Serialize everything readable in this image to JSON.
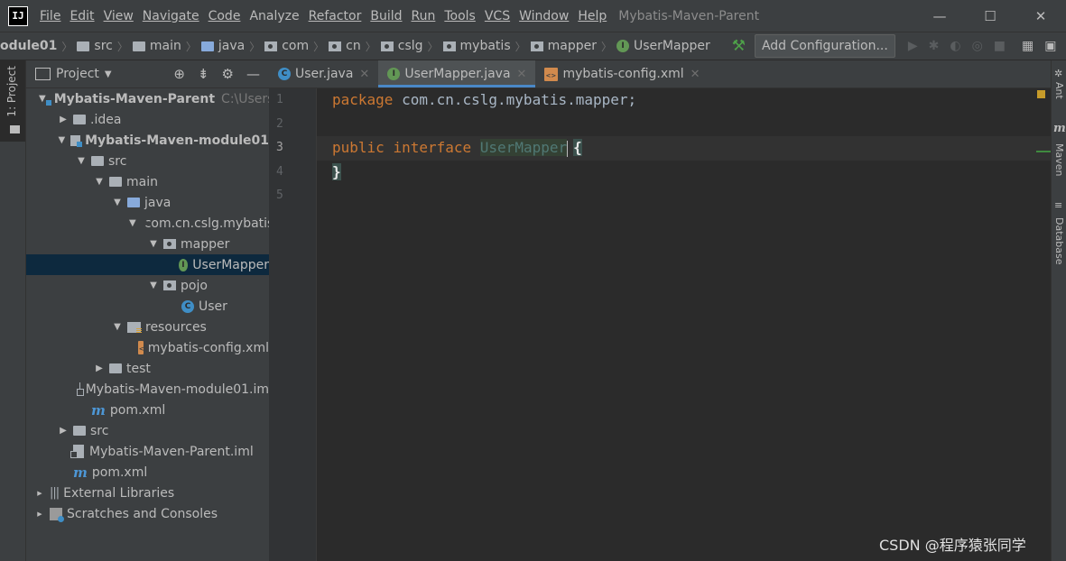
{
  "titlebar": {
    "logo": "IJ",
    "menu": [
      "File",
      "Edit",
      "View",
      "Navigate",
      "Code",
      "Analyze",
      "Refactor",
      "Build",
      "Run",
      "Tools",
      "VCS",
      "Window",
      "Help"
    ],
    "window_title": "Mybatis-Maven-Parent",
    "controls": [
      "—",
      "☐",
      "✕"
    ]
  },
  "navbar": {
    "crumbs": [
      "odule01",
      "src",
      "main",
      "java",
      "com",
      "cn",
      "cslg",
      "mybatis",
      "mapper",
      "UserMapper"
    ],
    "add_config": "Add Configuration..."
  },
  "leftstrip": {
    "project_tab": "1: Project"
  },
  "project_panel": {
    "title": "Project",
    "tree": [
      {
        "label": "Mybatis-Maven-Parent",
        "extra": "C:\\Users\\",
        "indent": 0,
        "arrow": "▼",
        "icon": "module",
        "bold": true
      },
      {
        "label": ".idea",
        "indent": 1,
        "arrow": "▶",
        "icon": "folder"
      },
      {
        "label": "Mybatis-Maven-module01",
        "indent": 1,
        "arrow": "▼",
        "icon": "module",
        "bold": true
      },
      {
        "label": "src",
        "indent": 2,
        "arrow": "▼",
        "icon": "folder"
      },
      {
        "label": "main",
        "indent": 3,
        "arrow": "▼",
        "icon": "folder"
      },
      {
        "label": "java",
        "indent": 4,
        "arrow": "▼",
        "icon": "folder-blue"
      },
      {
        "label": "com.cn.cslg.mybatis",
        "indent": 5,
        "arrow": "▼",
        "icon": "package"
      },
      {
        "label": "mapper",
        "indent": 6,
        "arrow": "▼",
        "icon": "package"
      },
      {
        "label": "UserMapper",
        "indent": 7,
        "arrow": "",
        "icon": "interface",
        "selected": true
      },
      {
        "label": "pojo",
        "indent": 6,
        "arrow": "▼",
        "icon": "package"
      },
      {
        "label": "User",
        "indent": 7,
        "arrow": "",
        "icon": "class"
      },
      {
        "label": "resources",
        "indent": 4,
        "arrow": "▼",
        "icon": "resources"
      },
      {
        "label": "mybatis-config.xml",
        "indent": 5,
        "arrow": "",
        "icon": "xml"
      },
      {
        "label": "test",
        "indent": 3,
        "arrow": "▶",
        "icon": "folder"
      },
      {
        "label": "Mybatis-Maven-module01.im",
        "indent": 2,
        "arrow": "",
        "icon": "iml"
      },
      {
        "label": "pom.xml",
        "indent": 2,
        "arrow": "",
        "icon": "maven"
      },
      {
        "label": "src",
        "indent": 1,
        "arrow": "▶",
        "icon": "folder"
      },
      {
        "label": "Mybatis-Maven-Parent.iml",
        "indent": 1,
        "arrow": "",
        "icon": "iml"
      },
      {
        "label": "pom.xml",
        "indent": 1,
        "arrow": "",
        "icon": "maven"
      },
      {
        "label": "External Libraries",
        "indent": 0,
        "arrow": "sm",
        "icon": "library"
      },
      {
        "label": "Scratches and Consoles",
        "indent": 0,
        "arrow": "sm",
        "icon": "scratch"
      }
    ]
  },
  "editor": {
    "tabs": [
      {
        "label": "User.java",
        "icon": "class",
        "active": false
      },
      {
        "label": "UserMapper.java",
        "icon": "interface",
        "active": true
      },
      {
        "label": "mybatis-config.xml",
        "icon": "xml",
        "active": false
      }
    ],
    "line_numbers": [
      "1",
      "2",
      "3",
      "4",
      "5"
    ],
    "code": {
      "line1_kw": "package",
      "line1_rest": " com.cn.cslg.mybatis.mapper;",
      "line3_kw1": "public",
      "line3_kw2": "interface",
      "line3_name": "UserMapper",
      "line3_brace": "{",
      "line4_brace": "}"
    }
  },
  "rightstrip": {
    "tabs": [
      "Ant",
      "Maven",
      "Database"
    ]
  },
  "watermark": "CSDN @程序猿张同学"
}
